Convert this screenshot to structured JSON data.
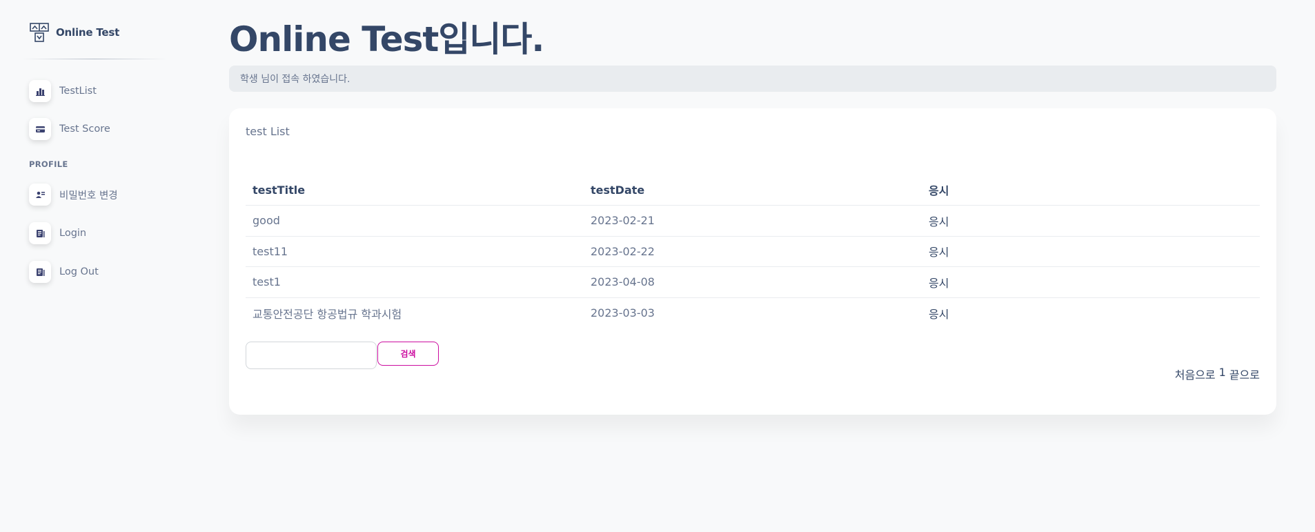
{
  "brand": {
    "name": "Online Test",
    "icon": "test-logo-icon"
  },
  "sidebar": {
    "items": [
      {
        "label": "TestList",
        "icon": "chart-bar-icon"
      },
      {
        "label": "Test Score",
        "icon": "credit-card-icon"
      }
    ],
    "section_heading": "PROFILE",
    "profile_items": [
      {
        "label": "비밀번호 변경",
        "icon": "user-key-icon"
      },
      {
        "label": "Login",
        "icon": "document-icon"
      },
      {
        "label": "Log Out",
        "icon": "document-icon"
      }
    ]
  },
  "header": {
    "title": "Online Test입니다.",
    "notice": "학생 님이 접속 하였습니다."
  },
  "main": {
    "card_title": "test List",
    "table": {
      "columns": [
        "testTitle",
        "testDate",
        "응시"
      ],
      "rows": [
        {
          "title": "good",
          "date": "2023-02-21",
          "action": "응시"
        },
        {
          "title": "test11",
          "date": "2023-02-22",
          "action": "응시"
        },
        {
          "title": "test1",
          "date": "2023-04-08",
          "action": "응시"
        },
        {
          "title": "교통안전공단 항공법규 학과시험",
          "date": "2023-03-03",
          "action": "응시"
        }
      ]
    },
    "search": {
      "value": "",
      "button_label": "검색"
    },
    "pagination": {
      "first": "처음으로",
      "current": "1",
      "last": "끝으로"
    }
  },
  "colors": {
    "text_dark": "#344767",
    "text_muted": "#67748e",
    "accent": "#cb0c9f",
    "background": "#f8f9fa"
  }
}
